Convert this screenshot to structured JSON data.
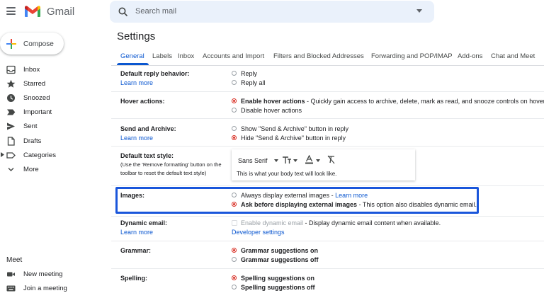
{
  "header": {
    "brand": "Gmail",
    "search_placeholder": "Search mail"
  },
  "sidebar": {
    "compose_label": "Compose",
    "items": [
      {
        "label": "Inbox",
        "icon": "inbox-icon"
      },
      {
        "label": "Starred",
        "icon": "star-icon"
      },
      {
        "label": "Snoozed",
        "icon": "clock-icon"
      },
      {
        "label": "Important",
        "icon": "important-icon"
      },
      {
        "label": "Sent",
        "icon": "send-icon"
      },
      {
        "label": "Drafts",
        "icon": "draft-icon"
      },
      {
        "label": "Categories",
        "icon": "label-icon"
      },
      {
        "label": "More",
        "icon": "chevron-down-icon"
      }
    ],
    "meet_heading": "Meet",
    "meet_items": [
      {
        "label": "New meeting",
        "icon": "video-icon"
      },
      {
        "label": "Join a meeting",
        "icon": "keyboard-icon"
      }
    ]
  },
  "settings": {
    "title": "Settings",
    "tabs": [
      "General",
      "Labels",
      "Inbox",
      "Accounts and Import",
      "Filters and Blocked Addresses",
      "Forwarding and POP/IMAP",
      "Add-ons",
      "Chat and Meet"
    ],
    "active_tab": "General",
    "reply": {
      "label": "Default reply behavior:",
      "link": "Learn more",
      "options": [
        "Reply",
        "Reply all"
      ]
    },
    "hover": {
      "label": "Hover actions:",
      "opt1_bold": "Enable hover actions",
      "opt1_rest": " - Quickly gain access to archive, delete, mark as read, and snooze controls on hover.",
      "opt2": "Disable hover actions"
    },
    "send_archive": {
      "label": "Send and Archive:",
      "link": "Learn more",
      "opt1": "Show \"Send & Archive\" button in reply",
      "opt2": "Hide \"Send & Archive\" button in reply"
    },
    "text_style": {
      "label": "Default text style:",
      "note_line1": "(Use the 'Remove formatting' button on the",
      "note_line2": "toolbar to reset the default text style)",
      "font": "Sans Serif",
      "preview": "This is what your body text will look like."
    },
    "images": {
      "label": "Images:",
      "opt1": "Always display external images",
      "opt1_sep": " - ",
      "opt1_link": "Learn more",
      "opt2_bold": "Ask before displaying external images",
      "opt2_rest": " - This option also disables dynamic email."
    },
    "dynamic": {
      "label": "Dynamic email:",
      "link": "Learn more",
      "opt_muted": "Enable dynamic email",
      "opt_rest": " - Display dynamic email content when available.",
      "dev_link": "Developer settings"
    },
    "grammar": {
      "label": "Grammar:",
      "opt1": "Grammar suggestions on",
      "opt2": "Grammar suggestions off"
    },
    "spelling": {
      "label": "Spelling:",
      "opt1": "Spelling suggestions on",
      "opt2": "Spelling suggestions off"
    }
  },
  "colors": {
    "accent": "#0b57d0",
    "radio_selected": "#d93025",
    "highlight_box": "#1a56db"
  }
}
